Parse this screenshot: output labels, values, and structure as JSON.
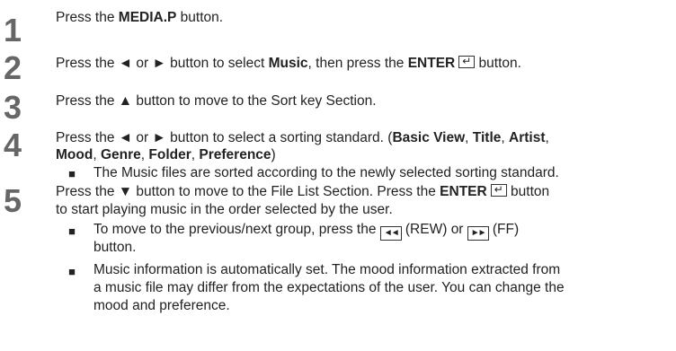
{
  "steps": [
    {
      "num": "1"
    },
    {
      "num": "2"
    },
    {
      "num": "3"
    },
    {
      "num": "4"
    },
    {
      "num": "5"
    }
  ],
  "s1": {
    "a": "Press the ",
    "b": "MEDIA.P",
    "c": " button."
  },
  "s2": {
    "a": "Press the ◄ or ► button to select ",
    "b": "Music",
    "c": ", then press the ",
    "d": "ENTER",
    "e": " button."
  },
  "s3": {
    "a": "Press the ▲ button to move to the Sort key Section."
  },
  "s4": {
    "a": "Press the ◄ or ► button to select a sorting standard. (",
    "b": "Basic View",
    "c": ", ",
    "d": "Title",
    "e": ", ",
    "f": "Artist",
    "g": ",",
    "h": "Mood",
    "i": ", ",
    "j": "Genre",
    "k": ", ",
    "l": "Folder",
    "m": ", ",
    "n": "Preference",
    "o": ")",
    "bullet": "The Music files are sorted according to the newly selected sorting standard."
  },
  "s5": {
    "a": "Press the ▼ button to move to the File List Section. Press the ",
    "b": "ENTER",
    "c": " button",
    "line2": "to start playing music in the order selected by the user.",
    "bullet1a": "To move to the previous/next group, press the ",
    "rew_icon": "◄◄",
    "bullet1b": " (REW) or ",
    "ff_icon": "►►",
    "bullet1c": " (FF)",
    "bullet1d": "button.",
    "bullet2a": "Music information is automatically set. The mood information extracted from",
    "bullet2b": "a music file may differ from the expectations of the user. You can change the",
    "bullet2c": "mood and preference."
  },
  "bullet_mark": "■"
}
